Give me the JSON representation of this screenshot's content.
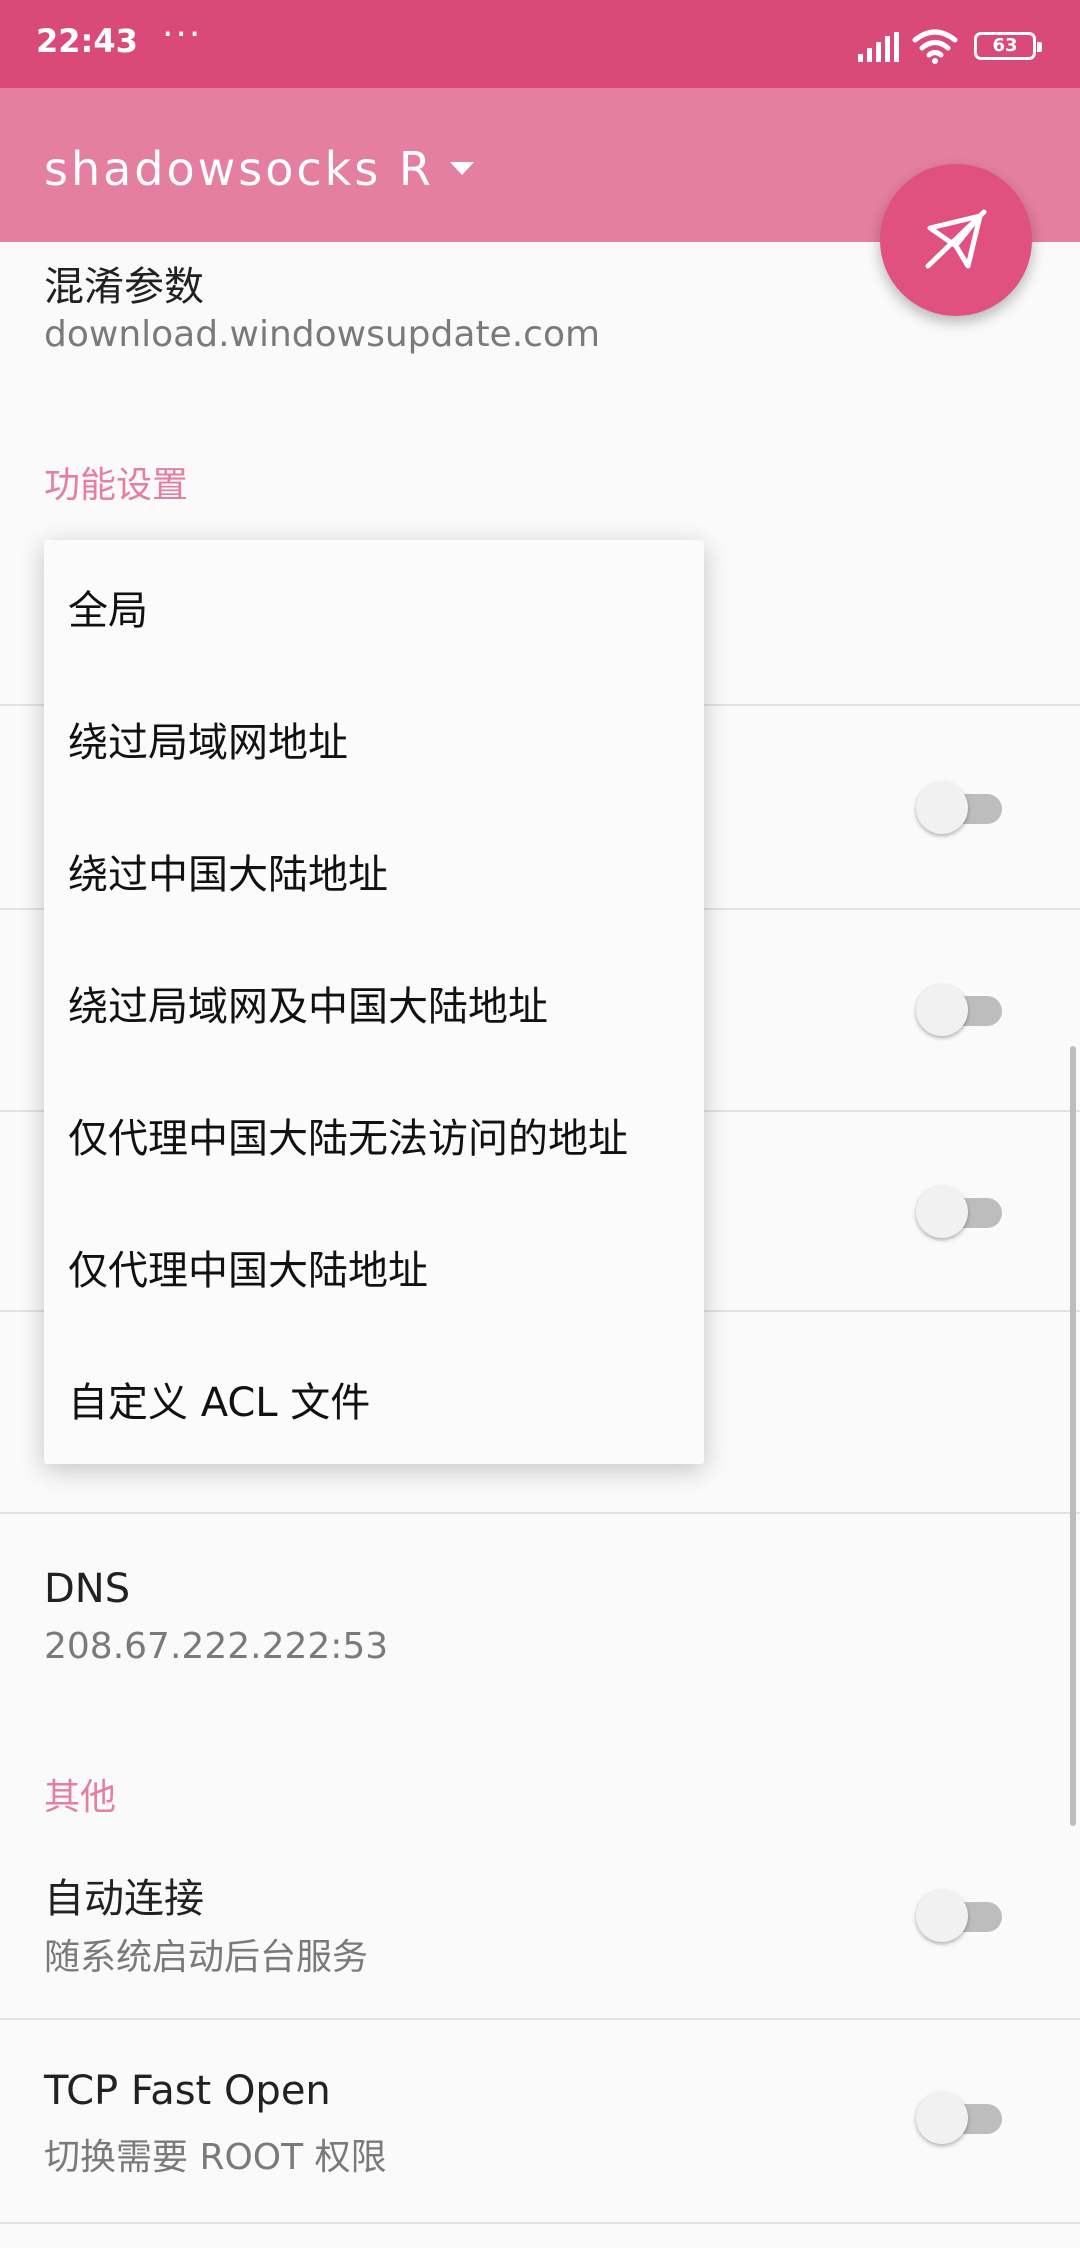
{
  "status_bar": {
    "time": "22:43",
    "dots": "···",
    "battery": "63",
    "icons": [
      "signal-icon",
      "wifi-icon",
      "battery-icon"
    ]
  },
  "toolbar": {
    "title": "shadowsocks R",
    "caret_icon": "dropdown-caret-icon",
    "fab_icon": "paper-plane-off-icon",
    "color": "#e57f9f",
    "fab_color": "#e0517f"
  },
  "settings": {
    "obfs_param": {
      "title": "混淆参数",
      "value": "download.windowsupdate.com"
    },
    "section_feature": "功能设置",
    "dns": {
      "title": "DNS",
      "value": "208.67.222.222:53"
    },
    "section_other": "其他",
    "auto_connect": {
      "title": "自动连接",
      "subtitle": "随系统启动后台服务",
      "enabled": false
    },
    "tcp_fast_open": {
      "title": "TCP Fast Open",
      "subtitle": "切换需要 ROOT 权限",
      "enabled": false
    }
  },
  "dropdown": {
    "items": [
      "全局",
      "绕过局域网地址",
      "绕过中国大陆地址",
      "绕过局域网及中国大陆地址",
      "仅代理中国大陆无法访问的地址",
      "仅代理中国大陆地址",
      "自定义 ACL 文件"
    ]
  }
}
